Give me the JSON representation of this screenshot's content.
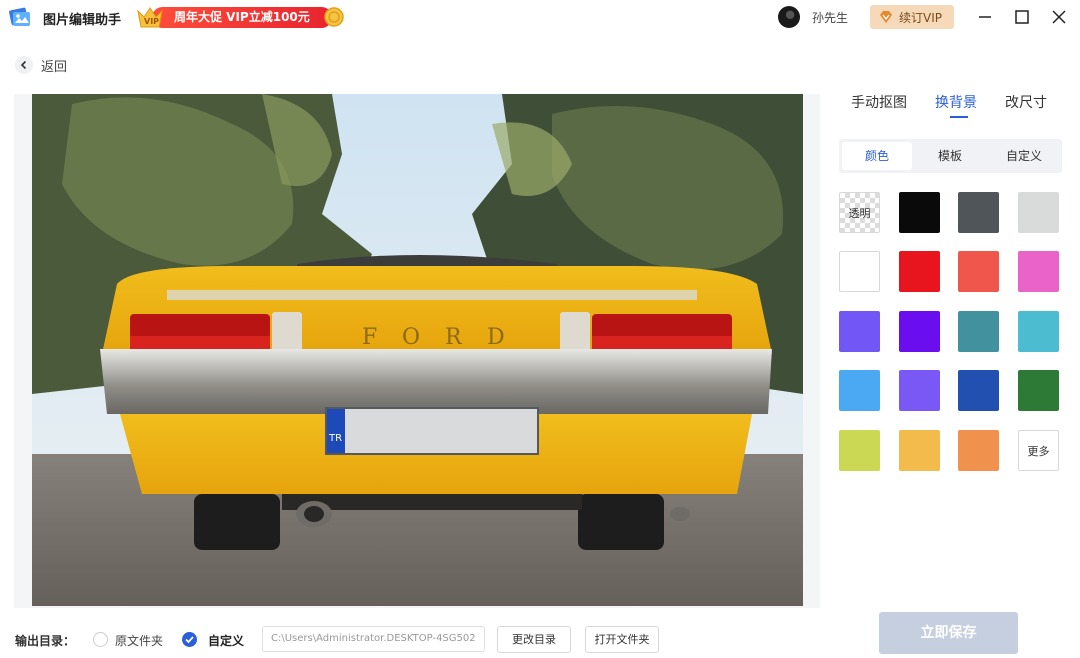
{
  "app": {
    "title": "图片编辑助手"
  },
  "promo": {
    "text": "周年大促 VIP立减100元"
  },
  "user": {
    "name": "孙先生"
  },
  "vip_button": {
    "label": "续订VIP"
  },
  "nav": {
    "back_label": "返回"
  },
  "tabs": [
    {
      "label": "手动抠图",
      "active": false
    },
    {
      "label": "换背景",
      "active": true
    },
    {
      "label": "改尺寸",
      "active": false
    }
  ],
  "subtabs": [
    {
      "label": "颜色",
      "active": true
    },
    {
      "label": "模板",
      "active": false
    },
    {
      "label": "自定义",
      "active": false
    }
  ],
  "swatches": [
    {
      "label": "透明",
      "color": "transparent"
    },
    {
      "color": "#0a0a0a"
    },
    {
      "color": "#4f5558"
    },
    {
      "color": "#d9dbda"
    },
    {
      "color": "#ffffff"
    },
    {
      "color": "#e8151f"
    },
    {
      "color": "#f0564b"
    },
    {
      "color": "#ea63c9"
    },
    {
      "color": "#7357f6"
    },
    {
      "color": "#6a0ef0"
    },
    {
      "color": "#41929e"
    },
    {
      "color": "#4cbcd0"
    },
    {
      "color": "#4ba9f4"
    },
    {
      "color": "#7a58f5"
    },
    {
      "color": "#2250b0"
    },
    {
      "color": "#2c7a36"
    },
    {
      "color": "#cbd854"
    },
    {
      "color": "#f3bb4c"
    },
    {
      "color": "#f0924d"
    },
    {
      "label": "更多",
      "color": "#ffffff"
    }
  ],
  "output": {
    "label": "输出目录：",
    "option_original": "原文件夹",
    "option_custom": "自定义",
    "selected": "自定义",
    "path_value": "C:\\Users\\Administrator.DESKTOP-4SG502",
    "change_dir_label": "更改目录",
    "open_folder_label": "打开文件夹"
  },
  "save_button": {
    "label": "立即保存"
  },
  "photo": {
    "plate_prefix": "TR",
    "brand_letters": [
      "F",
      "O",
      "R",
      "D"
    ]
  },
  "colors": {
    "accent": "#2b5fd9",
    "save_disabled": "#c6cfe0",
    "promo_red": "#e8242e",
    "vip_gold": "#f6d9b8"
  }
}
